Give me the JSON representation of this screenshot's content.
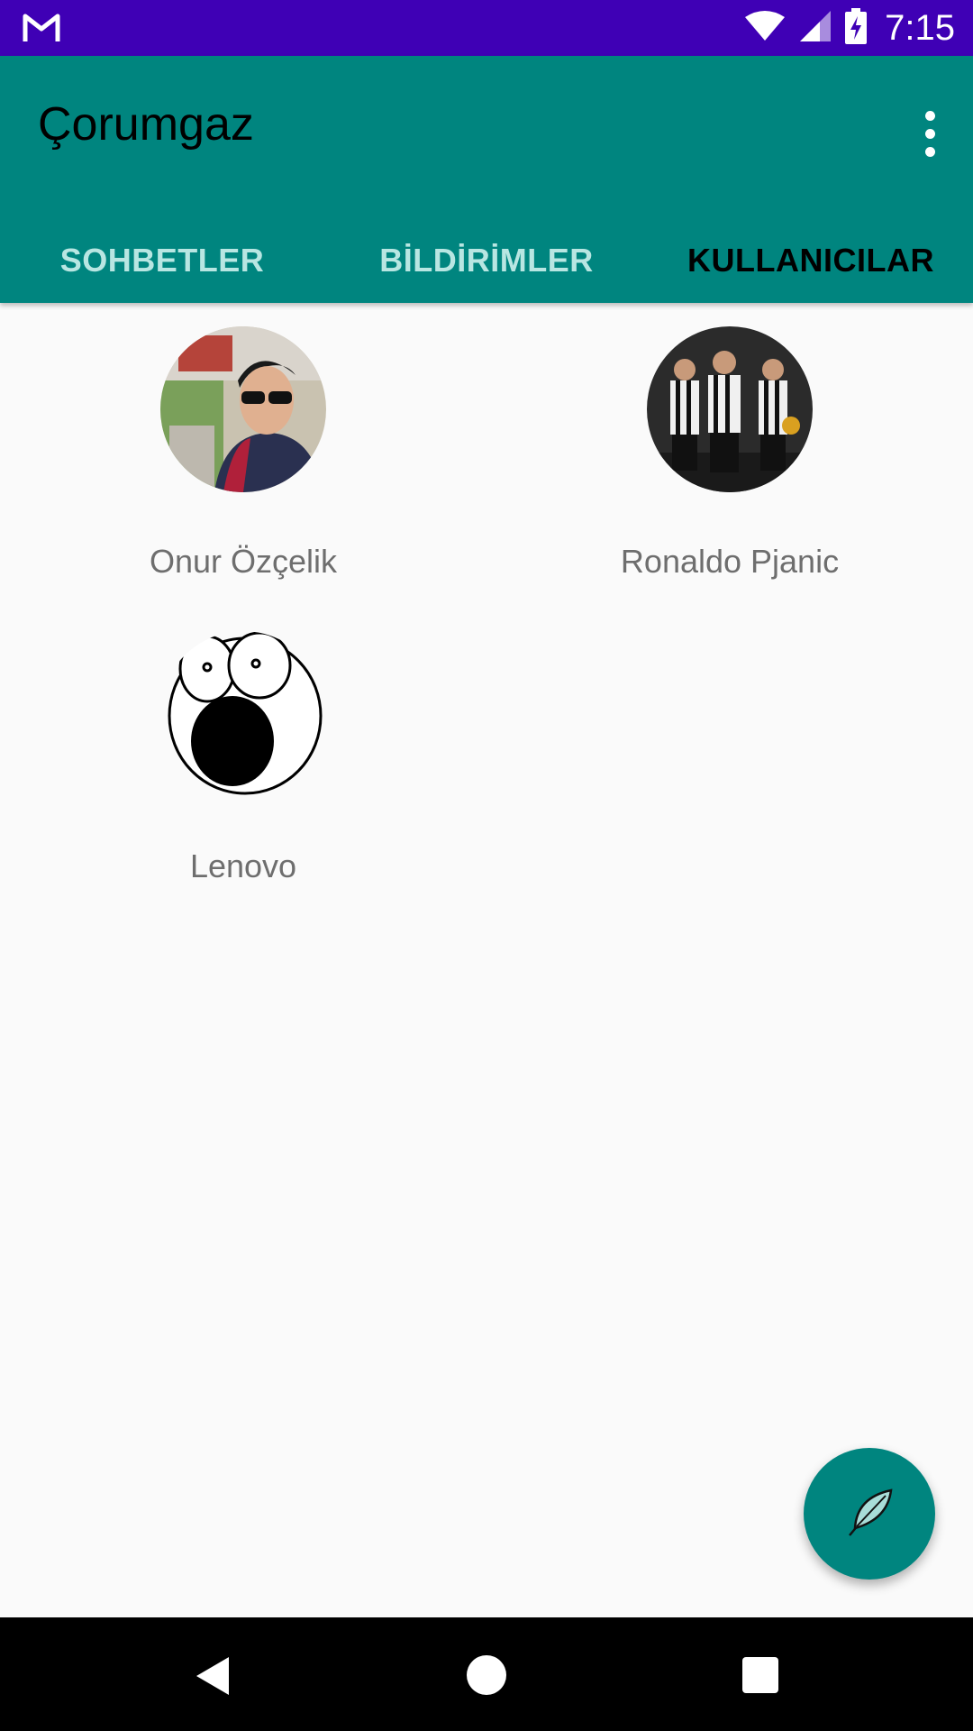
{
  "status_bar": {
    "time": "7:15",
    "icons": [
      "gmail-icon",
      "wifi-icon",
      "cell-signal-icon",
      "battery-charging-icon"
    ]
  },
  "app_bar": {
    "title": "Çorumgaz",
    "menu_icon": "more-vert-icon",
    "accent_color": "#00857f",
    "status_bar_color": "#3f00b5"
  },
  "tabs": [
    {
      "label": "SOHBETLER",
      "active": false
    },
    {
      "label": "BİLDİRİMLER",
      "active": false
    },
    {
      "label": "KULLANICILAR",
      "active": true
    }
  ],
  "users": [
    {
      "name": "Onur Özçelik",
      "avatar": "user-photo-avatar"
    },
    {
      "name": "Ronaldo Pjanic",
      "avatar": "football-players-avatar"
    },
    {
      "name": "Lenovo",
      "avatar": "shocked-face-avatar"
    }
  ],
  "fab": {
    "icon": "feather-icon"
  },
  "nav_bar": {
    "icons": [
      "back-icon",
      "home-icon",
      "recents-icon"
    ]
  }
}
